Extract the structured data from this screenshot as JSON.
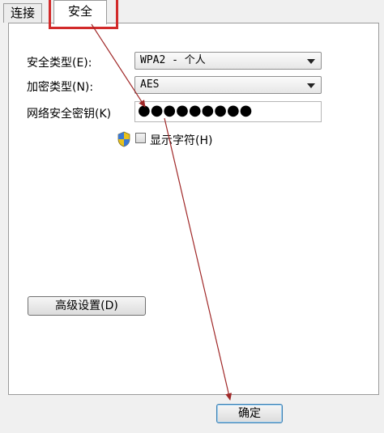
{
  "tabs": [
    {
      "label": "连接"
    },
    {
      "label": "安全"
    }
  ],
  "form": {
    "security_type": {
      "label": "安全类型(E):",
      "value": "WPA2 - 个人"
    },
    "encryption_type": {
      "label": "加密类型(N):",
      "value": "AES"
    },
    "network_key": {
      "label": "网络安全密钥(K)",
      "value": "●●●●●●●●●"
    },
    "show_characters": {
      "label": "显示字符(H)",
      "checked": false
    }
  },
  "buttons": {
    "advanced": "高级设置(D)",
    "ok": "确定"
  },
  "colors": {
    "highlight": "#d22a2a",
    "arrow": "#a02828"
  }
}
